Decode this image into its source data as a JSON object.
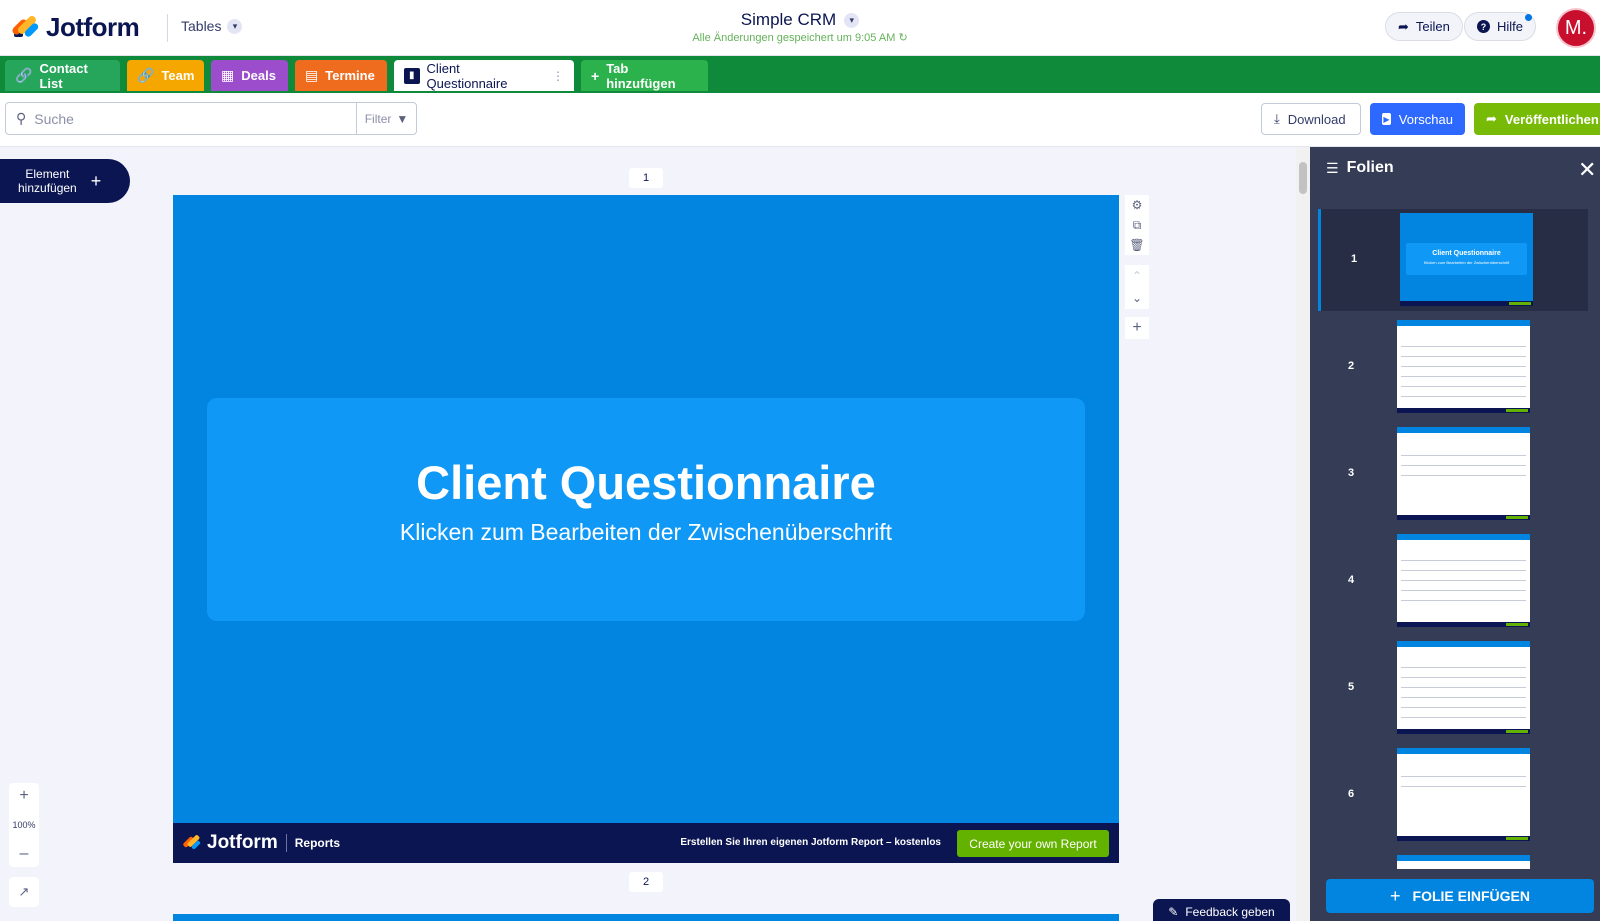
{
  "header": {
    "logo_text": "Jotform",
    "tables_label": "Tables",
    "doc_title": "Simple CRM",
    "save_status": "Alle Änderungen gespeichert um 9:05 AM",
    "share_label": "Teilen",
    "help_label": "Hilfe",
    "avatar_initial": "M."
  },
  "tabs": [
    {
      "label": "Contact List",
      "icon": "link-icon",
      "color": "#26a65b"
    },
    {
      "label": "Team",
      "icon": "link-icon",
      "color": "#f5a700"
    },
    {
      "label": "Deals",
      "icon": "table-icon",
      "color": "#9c4dcc"
    },
    {
      "label": "Termine",
      "icon": "calendar-icon",
      "color": "#ef6c1f"
    },
    {
      "label": "Client Questionnaire",
      "icon": "report-icon",
      "active": true
    },
    {
      "label": "Tab hinzufügen",
      "icon": "plus-icon",
      "color": "#2bb24c"
    }
  ],
  "toolbar": {
    "search_placeholder": "Suche",
    "filter_label": "Filter",
    "download_label": "Download",
    "preview_label": "Vorschau",
    "publish_label": "Veröffentlichen"
  },
  "canvas": {
    "add_element_line1": "Element",
    "add_element_line2": "hinzufügen",
    "slide1_number": "1",
    "slide2_number": "2",
    "slide_title": "Client Questionnaire",
    "slide_subtitle": "Klicken zum Bearbeiten der Zwischenüberschrift",
    "footer_logo": "Jotform",
    "footer_product": "Reports",
    "footer_cta_text": "Erstellen Sie Ihren eigenen Jotform Report – kostenlos",
    "footer_cta_button": "Create your own Report",
    "zoom_level": "100%",
    "feedback_label": "Feedback geben"
  },
  "panel": {
    "title": "Folien",
    "thumb_title": "Client Questionnaire",
    "thumb_subtitle": "Klicken zum Bearbeiten der Zwischenüberschrift",
    "slides": [
      "1",
      "2",
      "3",
      "4",
      "5",
      "6"
    ],
    "insert_label": "FOLIE EINFÜGEN"
  }
}
